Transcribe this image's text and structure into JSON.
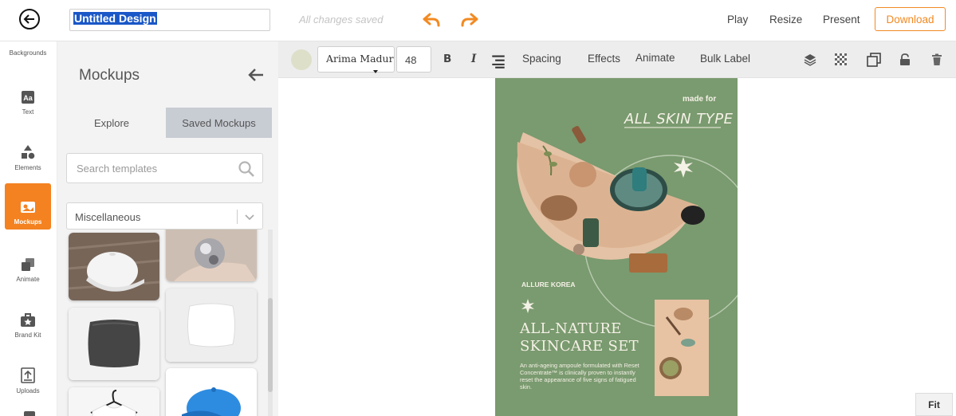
{
  "topbar": {
    "design_title": "Untitled Design",
    "saved_status": "All changes saved",
    "play_label": "Play",
    "resize_label": "Resize",
    "present_label": "Present",
    "download_label": "Download",
    "accent_color": "#f28a22"
  },
  "leftnav": {
    "backgrounds_label": "Backgrounds",
    "items": [
      {
        "label": "Text",
        "icon": "text-icon"
      },
      {
        "label": "Elements",
        "icon": "elements-icon"
      },
      {
        "label": "Mockups",
        "icon": "mockups-icon",
        "active": true
      },
      {
        "label": "Animate",
        "icon": "animate-icon"
      },
      {
        "label": "Brand Kit",
        "icon": "brand-kit-icon"
      },
      {
        "label": "Uploads",
        "icon": "uploads-icon"
      }
    ]
  },
  "panel": {
    "title": "Mockups",
    "tabs": [
      "Explore",
      "Saved Mockups"
    ],
    "search_placeholder": "Search templates",
    "category": "Miscellaneous"
  },
  "toolbar": {
    "font_name": "Arima Madurai",
    "font_size": "48",
    "bold": "B",
    "italic": "I",
    "spacing_label": "Spacing",
    "effects_label": "Effects",
    "animate_label": "Animate",
    "bulk_label": "Bulk Label",
    "swatch_color": "#dedfc9"
  },
  "design": {
    "made_for": "made for",
    "skin_type": "ALL SKIN TYPE",
    "brand": "ALLURE KOREA",
    "headline_1": "ALL-NATURE",
    "headline_2": "SKINCARE SET",
    "body": "An anti-ageing ampoule formulated with Reset Concentrate™ is clinically proven to instantly reset the appearance of five signs of fatigued skin.",
    "background_color": "#7a9a6f"
  },
  "canvas": {
    "fit_label": "Fit"
  }
}
